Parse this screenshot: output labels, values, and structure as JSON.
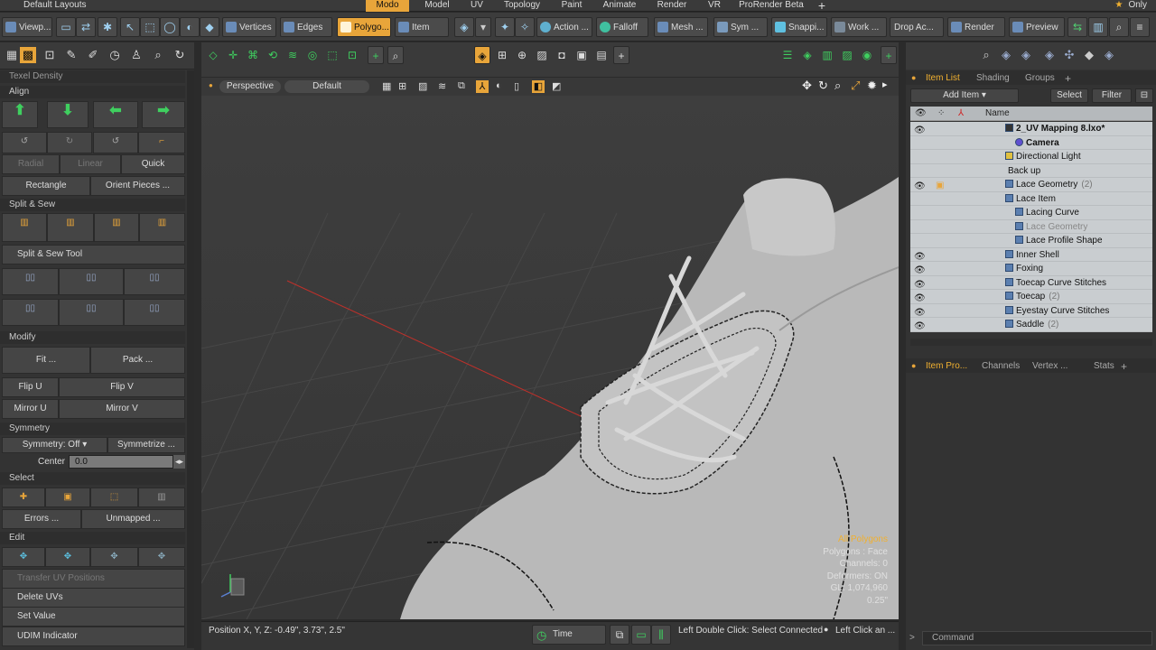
{
  "layout_title": "Default Layouts",
  "main_tabs": [
    "Modo",
    "Model",
    "UV",
    "Topology",
    "Paint",
    "Animate",
    "Render",
    "VR",
    "ProRender Beta"
  ],
  "active_main_tab": "Modo",
  "only_label": "Only",
  "toolbar": {
    "viewport": "Viewp...",
    "vertices": "Vertices",
    "edges": "Edges",
    "polygons": "Polygo...",
    "item": "Item",
    "action": "Action ...",
    "falloff": "Falloff",
    "mesh": "Mesh ...",
    "sym": "Sym ...",
    "snapping": "Snappi...",
    "work": "Work ...",
    "drop_action": "Drop Ac...",
    "render": "Render",
    "preview": "Preview"
  },
  "left": {
    "texel_density": "Texel Density",
    "align": "Align",
    "radial": "Radial",
    "linear": "Linear",
    "quick": "Quick",
    "rectangle": "Rectangle",
    "orient_pieces": "Orient Pieces ...",
    "split_sew": "Split & Sew",
    "split_sew_tool": "Split & Sew Tool",
    "modify": "Modify",
    "fit": "Fit ...",
    "pack": "Pack ...",
    "flip_u": "Flip U",
    "flip_v": "Flip V",
    "mirror_u": "Mirror U",
    "mirror_v": "Mirror V",
    "symmetry": "Symmetry",
    "symmetry_off": "Symmetry: Off",
    "symmetrize": "Symmetrize ...",
    "center_label": "Center",
    "center_value": "0.0",
    "select": "Select",
    "errors": "Errors ...",
    "unmapped": "Unmapped ...",
    "edit": "Edit",
    "transfer_uv": "Transfer UV Positions",
    "delete_uvs": "Delete UVs",
    "set_value": "Set Value",
    "udim": "UDIM Indicator"
  },
  "viewport": {
    "perspective": "Perspective",
    "default": "Default",
    "stats": {
      "all_polygons": "All Polygons",
      "polygons": "Polygons : Face",
      "channels": "Channels: 0",
      "deformers": "Deformers: ON",
      "gl": "GL: 1,074,960",
      "scale": "0.25\""
    }
  },
  "status": {
    "position": "Position X, Y, Z:   -0.49\", 3.73\", 2.5\"",
    "time": "Time",
    "hint1": "Left Double Click: Select Connected",
    "hint2": "Left Click an ..."
  },
  "right": {
    "tabs": [
      "Item List",
      "Shading",
      "Groups"
    ],
    "add_item": "Add Item",
    "select": "Select",
    "filter": "Filter",
    "name_header": "Name",
    "items": [
      {
        "name": "2_UV Mapping 8.lxo*",
        "count": ""
      },
      {
        "name": "Camera",
        "count": ""
      },
      {
        "name": "Directional Light",
        "count": ""
      },
      {
        "name": "Back up",
        "count": ""
      },
      {
        "name": "Lace Geometry",
        "count": "(2)"
      },
      {
        "name": "Lace Item",
        "count": ""
      },
      {
        "name": "Lacing Curve",
        "count": ""
      },
      {
        "name": "Lace Geometry",
        "count": ""
      },
      {
        "name": "Lace Profile Shape",
        "count": ""
      },
      {
        "name": "Inner Shell",
        "count": ""
      },
      {
        "name": "Foxing",
        "count": ""
      },
      {
        "name": "Toecap Curve Stitches",
        "count": ""
      },
      {
        "name": "Toecap",
        "count": "(2)"
      },
      {
        "name": "Eyestay Curve Stitches",
        "count": ""
      },
      {
        "name": "Saddle",
        "count": "(2)"
      }
    ],
    "prop_tabs": [
      "Item Pro...",
      "Channels",
      "Vertex ...",
      "Stats"
    ],
    "command": "Command"
  },
  "colors": {
    "accent": "#e8a53a",
    "panel": "#333333",
    "viewport": "#3d3d3d",
    "list_bg": "#c9cdd0"
  }
}
